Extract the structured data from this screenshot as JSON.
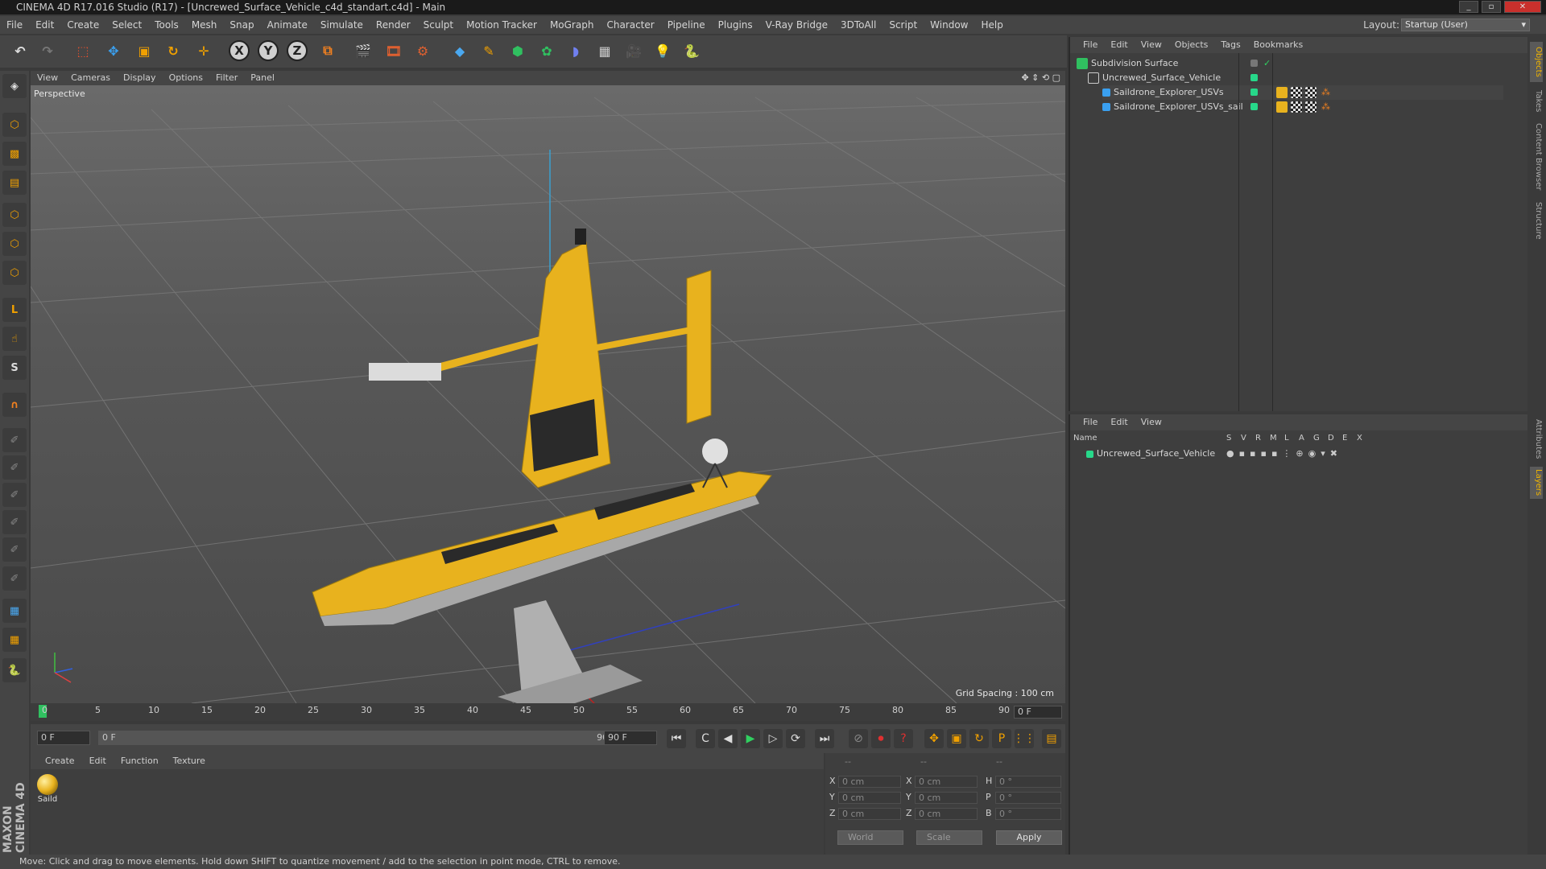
{
  "window": {
    "title": "CINEMA 4D R17.016 Studio (R17) - [Uncrewed_Surface_Vehicle_c4d_standart.c4d] - Main"
  },
  "menubar": {
    "items": [
      "File",
      "Edit",
      "Create",
      "Select",
      "Tools",
      "Mesh",
      "Snap",
      "Animate",
      "Simulate",
      "Render",
      "Sculpt",
      "Motion Tracker",
      "MoGraph",
      "Character",
      "Pipeline",
      "Plugins",
      "V-Ray Bridge",
      "3DToAll",
      "Script",
      "Window",
      "Help"
    ],
    "layout_label": "Layout:",
    "layout_value": "Startup (User)"
  },
  "toolbar": {
    "axis_x": "X",
    "axis_y": "Y",
    "axis_z": "Z"
  },
  "viewport": {
    "menu": [
      "View",
      "Cameras",
      "Display",
      "Options",
      "Filter",
      "Panel"
    ],
    "label": "Perspective",
    "grid_spacing": "Grid Spacing : 100 cm"
  },
  "timeline": {
    "ticks": [
      "0",
      "5",
      "10",
      "15",
      "20",
      "25",
      "30",
      "35",
      "40",
      "45",
      "50",
      "55",
      "60",
      "65",
      "70",
      "75",
      "80",
      "85",
      "90"
    ],
    "current_frame": "0 F"
  },
  "transport": {
    "start_field": "0 F",
    "range_start": "0 F",
    "range_end": "90 F",
    "end_field": "90 F"
  },
  "material_panel": {
    "menu": [
      "Create",
      "Edit",
      "Function",
      "Texture"
    ],
    "material_name": "Saild"
  },
  "coords": {
    "header_dashes": [
      "--",
      "--",
      "--"
    ],
    "rows": [
      {
        "l1": "X",
        "v1": "0 cm",
        "l2": "X",
        "v2": "0 cm",
        "l3": "H",
        "v3": "0 °"
      },
      {
        "l1": "Y",
        "v1": "0 cm",
        "l2": "Y",
        "v2": "0 cm",
        "l3": "P",
        "v3": "0 °"
      },
      {
        "l1": "Z",
        "v1": "0 cm",
        "l2": "Z",
        "v2": "0 cm",
        "l3": "B",
        "v3": "0 °"
      }
    ],
    "world": "World",
    "scale": "Scale",
    "apply": "Apply"
  },
  "object_manager": {
    "menu": [
      "File",
      "Edit",
      "View",
      "Objects",
      "Tags",
      "Bookmarks"
    ],
    "objects": [
      {
        "name": "Subdivision Surface",
        "indent": 0
      },
      {
        "name": "Uncrewed_Surface_Vehicle",
        "indent": 1
      },
      {
        "name": "Saildrone_Explorer_USVs",
        "indent": 2
      },
      {
        "name": "Saildrone_Explorer_USVs_sail",
        "indent": 2
      }
    ]
  },
  "attribute_manager": {
    "menu": [
      "File",
      "Edit",
      "View"
    ],
    "columns": [
      "Name",
      "S",
      "V",
      "R",
      "M",
      "L",
      "A",
      "G",
      "D",
      "E",
      "X"
    ],
    "layer_name": "Uncrewed_Surface_Vehicle"
  },
  "side_tabs": [
    "Objects",
    "Takes",
    "Content Browser",
    "Structure",
    "Attributes",
    "Layers"
  ],
  "brand": "MAXON CINEMA 4D",
  "status": "Move: Click and drag to move elements. Hold down SHIFT to quantize movement / add to the selection in point mode, CTRL to remove.",
  "colors": {
    "accent": "#f0b400",
    "vehicle": "#e8b21e",
    "layer_green": "#27d88a"
  }
}
